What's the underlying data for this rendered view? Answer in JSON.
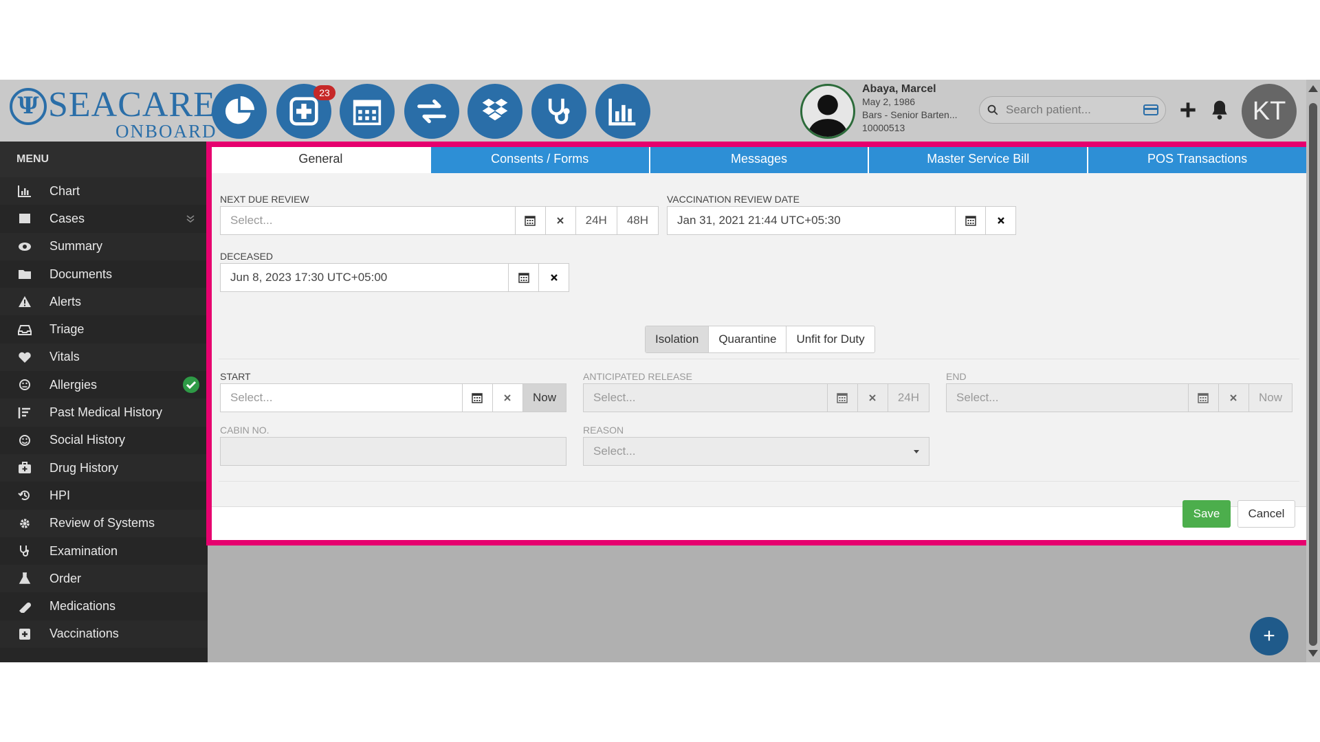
{
  "brand": {
    "name": "SEACARE",
    "sub": "ONBOARD"
  },
  "header": {
    "notifications_badge": "23",
    "search_placeholder": "Search patient...",
    "avatar_initials": "KT"
  },
  "patient": {
    "name": "Abaya, Marcel",
    "dob": "May 2, 1986",
    "role": "Bars - Senior Barten...",
    "id": "10000513"
  },
  "sidebar": {
    "title": "MENU",
    "items": [
      {
        "label": "Chart",
        "icon": "chart-icon"
      },
      {
        "label": "Cases",
        "icon": "cases-icon"
      },
      {
        "label": "Summary",
        "icon": "eye-icon"
      },
      {
        "label": "Documents",
        "icon": "folder-icon"
      },
      {
        "label": "Alerts",
        "icon": "warning-icon"
      },
      {
        "label": "Triage",
        "icon": "inbox-icon"
      },
      {
        "label": "Vitals",
        "icon": "heart-icon"
      },
      {
        "label": "Allergies",
        "icon": "allergy-icon"
      },
      {
        "label": "Past Medical History",
        "icon": "list-icon"
      },
      {
        "label": "Social History",
        "icon": "smile-icon"
      },
      {
        "label": "Drug History",
        "icon": "medkit-icon"
      },
      {
        "label": "HPI",
        "icon": "history-icon"
      },
      {
        "label": "Review of Systems",
        "icon": "cog-icon"
      },
      {
        "label": "Examination",
        "icon": "stethoscope-icon"
      },
      {
        "label": "Order",
        "icon": "flask-icon"
      },
      {
        "label": "Medications",
        "icon": "pill-icon"
      },
      {
        "label": "Vaccinations",
        "icon": "plus-square-icon"
      }
    ]
  },
  "tabs": [
    "General",
    "Consents / Forms",
    "Messages",
    "Master Service Bill",
    "POS Transactions"
  ],
  "form": {
    "next_due_review": {
      "label": "NEXT DUE REVIEW",
      "placeholder": "Select...",
      "opt1": "24H",
      "opt2": "48H"
    },
    "vaccination_review": {
      "label": "VACCINATION REVIEW DATE",
      "value": "Jan 31, 2021 21:44 UTC+05:30"
    },
    "deceased": {
      "label": "DECEASED",
      "value": "Jun 8, 2023 17:30 UTC+05:00"
    },
    "status_buttons": [
      "Isolation",
      "Quarantine",
      "Unfit for Duty"
    ],
    "start": {
      "label": "START",
      "placeholder": "Select...",
      "now": "Now"
    },
    "anticipated_release": {
      "label": "ANTICIPATED RELEASE",
      "placeholder": "Select...",
      "opt": "24H"
    },
    "end": {
      "label": "END",
      "placeholder": "Select...",
      "now": "Now"
    },
    "cabin_no": {
      "label": "CABIN NO.",
      "value": ""
    },
    "reason": {
      "label": "REASON",
      "placeholder": "Select..."
    },
    "save": "Save",
    "cancel": "Cancel"
  },
  "colors": {
    "accent": "#2d8fd6",
    "brand": "#2a6ea8",
    "highlight_border": "#e6006e",
    "save": "#4cae4c"
  }
}
